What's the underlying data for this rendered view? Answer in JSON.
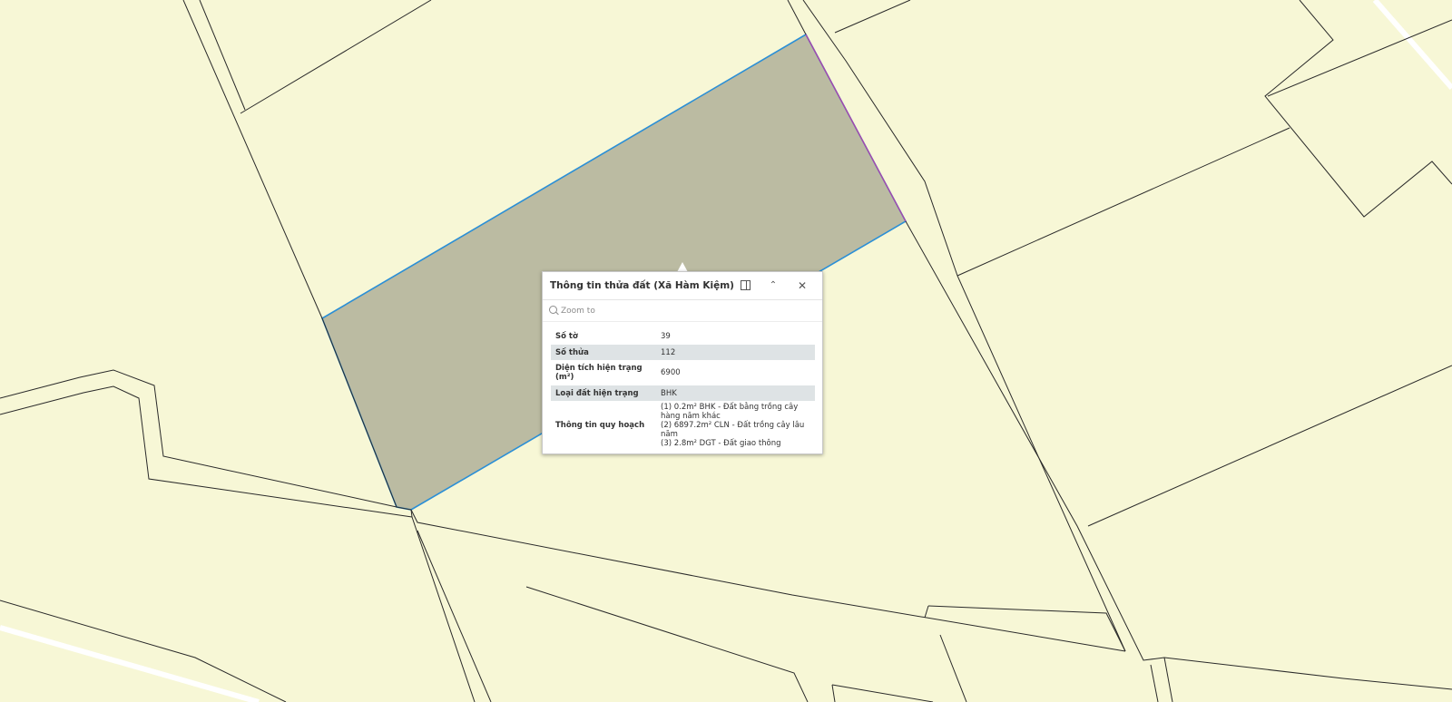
{
  "popup": {
    "title": "Thông tin thửa đất (Xã Hàm Kiệm)",
    "zoom_label": "Zoom to",
    "attributes": [
      {
        "key": "Số tờ",
        "value": "39"
      },
      {
        "key": "Số thửa",
        "value": "112"
      },
      {
        "key": "Diện tích hiện trạng (m²)",
        "value": "6900"
      },
      {
        "key": "Loại đất hiện trạng",
        "value": "BHK"
      },
      {
        "key": "Thông tin quy hoạch",
        "value_lines": [
          "(1) 0.2m² BHK - Đất bằng trồng cây hàng năm khác",
          "(2) 6897.2m² CLN - Đất trồng cây lâu năm",
          "(3) 2.8m² DGT - Đất giao thông"
        ]
      }
    ],
    "buttons": {
      "dock": "dock-icon",
      "collapse": "chevron-up-icon",
      "close": "close-icon"
    }
  },
  "map": {
    "background_color": "#f7f7d6",
    "selected_fill": "#bbbba2",
    "selected_outline": "#2b8fd6"
  }
}
